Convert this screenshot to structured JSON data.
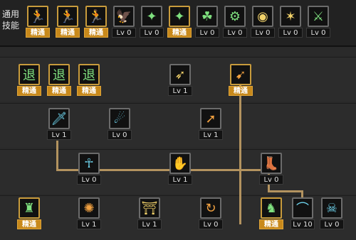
{
  "common_skills_label": "通用\n技能",
  "mastery_text": "精通",
  "top_row": [
    {
      "name": "common-skill-1-icon",
      "glyph": "🏃",
      "level": "精通",
      "color": "c-yellow",
      "gold": true
    },
    {
      "name": "common-skill-2-icon",
      "glyph": "🏃",
      "level": "精通",
      "color": "c-yellow",
      "gold": true
    },
    {
      "name": "common-skill-3-icon",
      "glyph": "🏃",
      "level": "精通",
      "color": "c-green",
      "gold": true
    },
    {
      "name": "common-skill-4-icon",
      "glyph": "🦅",
      "level": "Lv 0",
      "color": "c-yellow",
      "gold": false
    },
    {
      "name": "common-skill-5-icon",
      "glyph": "✦",
      "level": "Lv 0",
      "color": "c-green",
      "gold": false
    },
    {
      "name": "common-skill-6-icon",
      "glyph": "✦",
      "level": "精通",
      "color": "c-green",
      "gold": true
    },
    {
      "name": "common-skill-7-icon",
      "glyph": "☘",
      "level": "Lv 0",
      "color": "c-green",
      "gold": false
    },
    {
      "name": "common-skill-8-icon",
      "glyph": "⚙",
      "level": "Lv 0",
      "color": "c-green",
      "gold": false
    },
    {
      "name": "common-skill-9-icon",
      "glyph": "◉",
      "level": "Lv 0",
      "color": "c-yellow",
      "gold": false
    },
    {
      "name": "common-skill-10-icon",
      "glyph": "✶",
      "level": "Lv 0",
      "color": "c-yellow",
      "gold": false
    },
    {
      "name": "common-skill-11-icon",
      "glyph": "⚔",
      "level": "Lv 0",
      "color": "c-green",
      "gold": false
    }
  ],
  "row2": [
    {
      "name": "tree-skill-retreat-1-icon",
      "glyph": "退",
      "level": "精通",
      "color": "c-green",
      "gold": true
    },
    {
      "name": "tree-skill-retreat-2-icon",
      "glyph": "退",
      "level": "精通",
      "color": "c-green",
      "gold": true
    },
    {
      "name": "tree-skill-retreat-3-icon",
      "glyph": "退",
      "level": "精通",
      "color": "c-green",
      "gold": true
    },
    {
      "name": "tree-skill-dash-icon",
      "glyph": "➶",
      "level": "Lv 1",
      "color": "c-yellow",
      "gold": false
    },
    {
      "name": "tree-skill-slash-icon",
      "glyph": "➹",
      "level": "精通",
      "color": "c-orange",
      "gold": true
    }
  ],
  "row3": [
    {
      "name": "tree-skill-sword-icon",
      "glyph": "🗡",
      "level": "Lv 1",
      "color": "c-cyan",
      "gold": false
    },
    {
      "name": "tree-skill-kick-icon",
      "glyph": "☄",
      "level": "Lv 0",
      "color": "c-cyan",
      "gold": false
    },
    {
      "name": "tree-skill-strike-icon",
      "glyph": "➚",
      "level": "Lv 1",
      "color": "c-orange",
      "gold": false
    }
  ],
  "row4": [
    {
      "name": "tree-skill-ankh-icon",
      "glyph": "☥",
      "level": "Lv 0",
      "color": "c-cyan",
      "gold": false
    },
    {
      "name": "tree-skill-grab-icon",
      "glyph": "✋",
      "level": "Lv 1",
      "color": "c-orange",
      "gold": false
    },
    {
      "name": "tree-skill-boot-icon",
      "glyph": "👢",
      "level": "Lv 0",
      "color": "c-orange",
      "gold": false
    }
  ],
  "row5": [
    {
      "name": "tree-skill-guard-icon",
      "glyph": "♜",
      "level": "精通",
      "color": "c-green",
      "gold": true
    },
    {
      "name": "tree-skill-burst-icon",
      "glyph": "✺",
      "level": "Lv 1",
      "color": "c-orange",
      "gold": false
    },
    {
      "name": "tree-skill-pillar-icon",
      "glyph": "⛩",
      "level": "Lv 1",
      "color": "c-yellow",
      "gold": false
    },
    {
      "name": "tree-skill-swing-icon",
      "glyph": "↻",
      "level": "Lv 0",
      "color": "c-orange",
      "gold": false
    },
    {
      "name": "tree-skill-hero-icon",
      "glyph": "♞",
      "level": "精通",
      "color": "c-green",
      "gold": true
    },
    {
      "name": "tree-skill-wave-icon",
      "glyph": "⌒",
      "level": "Lv 10",
      "color": "c-cyan",
      "gold": false
    },
    {
      "name": "tree-skill-aura-icon",
      "glyph": "☠",
      "level": "Lv 0",
      "color": "c-cyan",
      "gold": false
    }
  ]
}
